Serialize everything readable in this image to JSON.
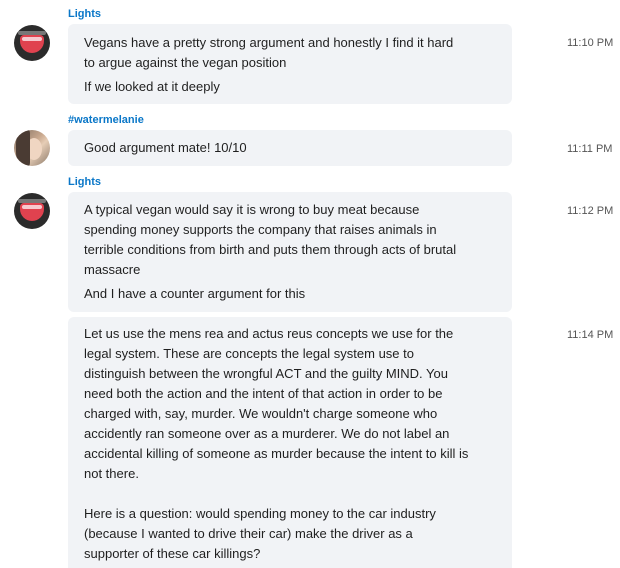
{
  "messages": [
    {
      "sender": "Lights",
      "time": "11:10 PM",
      "lines": [
        "Vegans have a pretty strong argument and honestly I find it hard",
        "to argue against the vegan position",
        "If we looked at it deeply"
      ]
    },
    {
      "sender": "#watermelanie",
      "time": "11:11 PM",
      "lines": [
        "Good argument mate! 10/10"
      ]
    },
    {
      "sender": "Lights",
      "time": "11:12 PM",
      "lines": [
        "A typical vegan would say it is wrong to buy meat because",
        "spending money supports the company that raises animals in",
        "terrible conditions from birth and puts them through acts of brutal",
        "massacre",
        "And I have a counter argument for this"
      ]
    },
    {
      "sender": "Lights",
      "time": "11:14 PM",
      "lines": [
        "Let us use the mens rea and actus reus concepts we use for the",
        "legal system. These are concepts the legal system use to",
        "distinguish between the wrongful ACT and the guilty MIND. You",
        "need both the action and the intent of that action in order to be",
        "charged with, say, murder. We wouldn't charge someone who",
        "accidently ran someone over as a murderer. We do not label an",
        "accidental killing of someone as murder because the intent to kill is",
        "not there.",
        "Here is a question: would spending money to the car industry",
        "(because I wanted to drive their car) make the driver as a",
        "supporter of these car killings?"
      ]
    }
  ]
}
